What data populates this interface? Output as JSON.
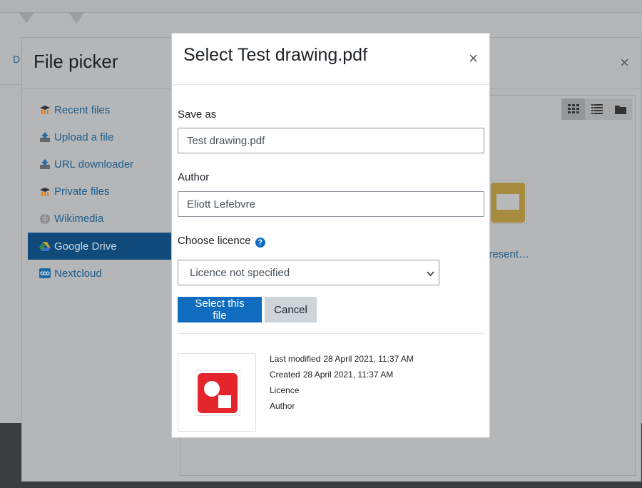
{
  "background": {
    "partial_text": "D"
  },
  "file_picker": {
    "title": "File picker",
    "close_glyph": "×",
    "nav": [
      {
        "label": "Recent files",
        "icon": "moodle-icon"
      },
      {
        "label": "Upload a file",
        "icon": "upload-icon"
      },
      {
        "label": "URL downloader",
        "icon": "url-downloader-icon"
      },
      {
        "label": "Private files",
        "icon": "moodle-icon"
      },
      {
        "label": "Wikimedia",
        "icon": "wikimedia-icon"
      },
      {
        "label": "Google Drive",
        "icon": "google-drive-icon",
        "active": true
      },
      {
        "label": "Nextcloud",
        "icon": "nextcloud-icon"
      }
    ],
    "view_buttons": [
      "grid-view-icon",
      "list-view-icon",
      "folder-view-icon"
    ],
    "file_label": "present…"
  },
  "modal": {
    "title": "Select Test drawing.pdf",
    "close_glyph": "×",
    "save_as_label": "Save as",
    "save_as_value": "Test drawing.pdf",
    "author_label": "Author",
    "author_value": "Eliott Lefebvre",
    "licence_label": "Choose licence",
    "licence_help_glyph": "?",
    "licence_selected": "Licence not specified",
    "select_button": "Select this file",
    "cancel_button": "Cancel",
    "meta": {
      "last_modified_label": "Last modified",
      "last_modified_value": "28 April 2021, 11:37 AM",
      "created_label": "Created",
      "created_value": "28 April 2021, 11:37 AM",
      "licence_label": "Licence",
      "author_label": "Author"
    }
  },
  "colors": {
    "primary": "#0f6cbf",
    "link": "#1e5d8c",
    "drawing_red": "#e3262b"
  }
}
